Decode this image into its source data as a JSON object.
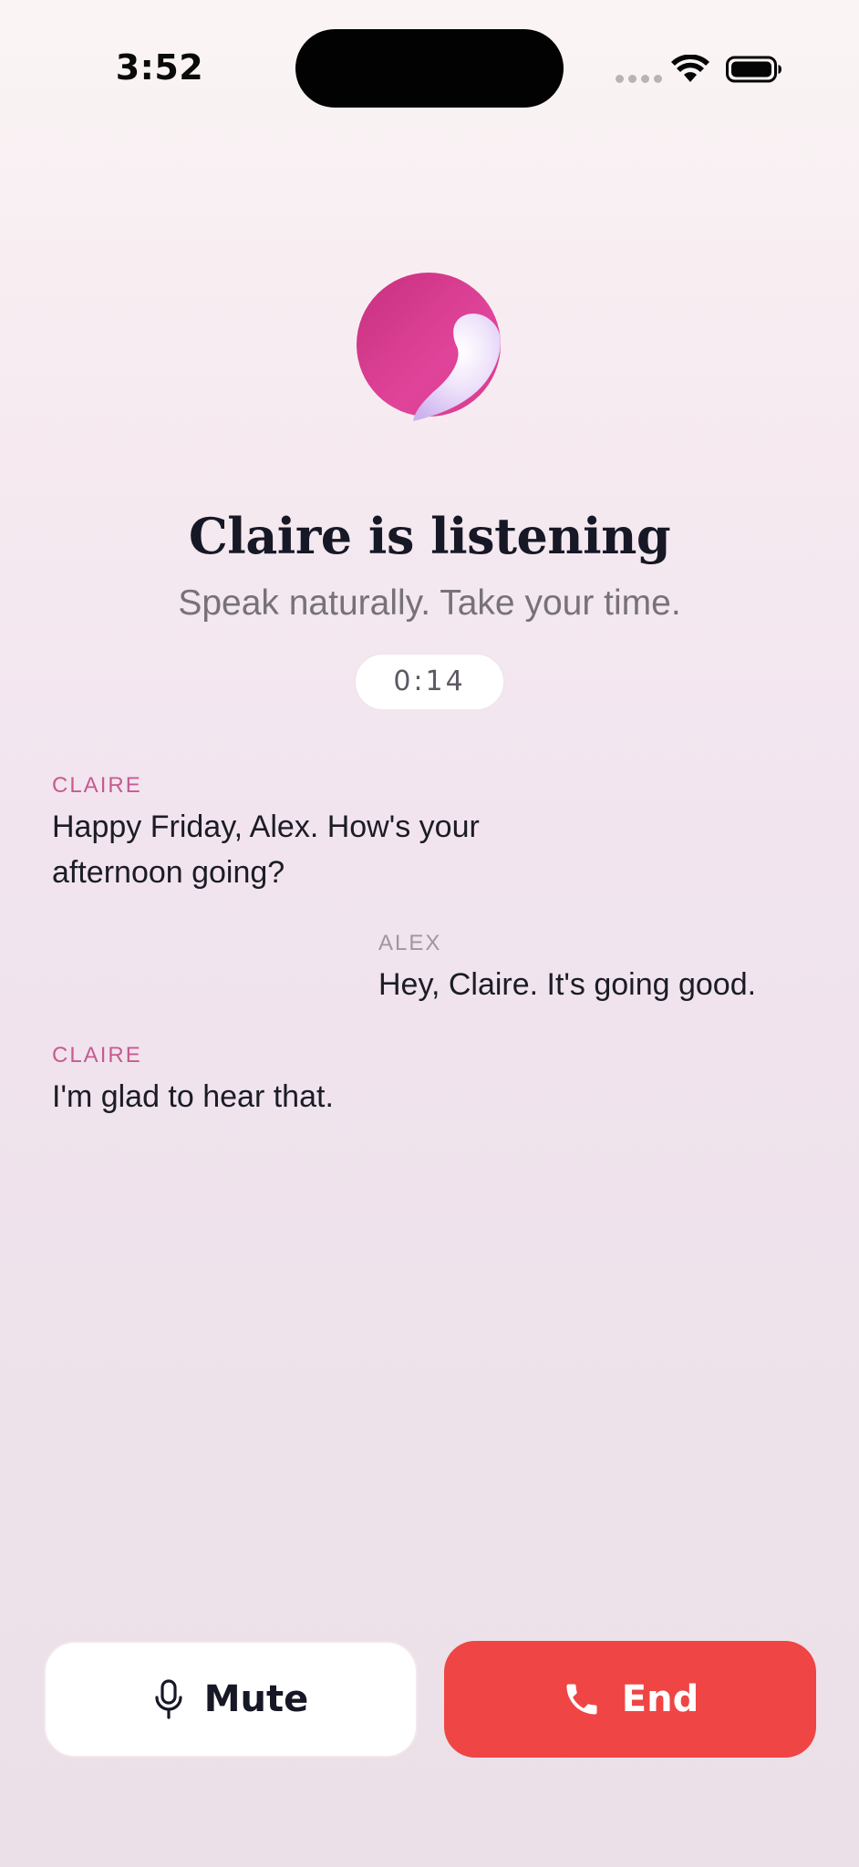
{
  "status_bar": {
    "time": "3:52"
  },
  "call": {
    "title": "Claire is listening",
    "subtitle": "Speak naturally. Take your time.",
    "timer": "0:14"
  },
  "transcript": [
    {
      "speaker": "CLAIRE",
      "text": "Happy Friday, Alex. How's your afternoon going?"
    },
    {
      "speaker": "ALEX",
      "text": "Hey, Claire. It's going good."
    },
    {
      "speaker": "CLAIRE",
      "text": "I'm glad to hear that."
    }
  ],
  "controls": {
    "mute_label": "Mute",
    "end_label": "End"
  },
  "colors": {
    "end_button": "#ef4545",
    "claire_label": "#c85a90",
    "alex_label": "#9d97a0",
    "avatar_magenta": "#d63b8c",
    "avatar_lavender": "#d9c3f2"
  },
  "icons": {
    "status": [
      "signal-dots-icon",
      "wifi-icon",
      "battery-icon"
    ],
    "mute": "microphone-icon",
    "end": "phone-icon",
    "avatar": "claire-avatar-icon"
  }
}
